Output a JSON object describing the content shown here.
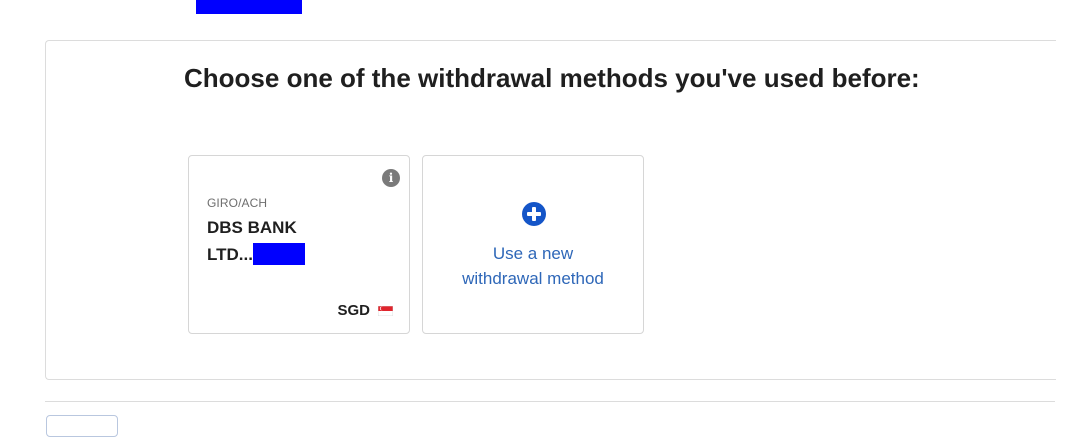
{
  "heading": "Choose one of the withdrawal methods you've used before:",
  "saved_method": {
    "type": "GIRO/ACH",
    "bank_line1": "DBS BANK",
    "bank_line2": "LTD...",
    "currency": "SGD",
    "flag": "singapore-flag",
    "info_icon": "info-icon"
  },
  "new_method": {
    "icon": "plus-circle-icon",
    "line1": "Use a new",
    "line2": "withdrawal method"
  },
  "colors": {
    "accent": "#1455c8",
    "link_text": "#2e67b8",
    "redaction": "#0000ff"
  }
}
